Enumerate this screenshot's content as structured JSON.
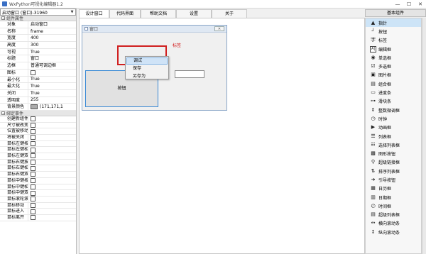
{
  "window": {
    "title": "WxPython可视化编辑器1.2",
    "minimize": "—",
    "maximize": "☐",
    "close": "✕"
  },
  "left": {
    "object_selector": "启动窗口 (窗口)-31960",
    "props_section": "组件属性",
    "props": [
      {
        "k": "对象",
        "v": "启动窗口"
      },
      {
        "k": "名称",
        "v": "frame"
      },
      {
        "k": "宽度",
        "v": "400"
      },
      {
        "k": "高度",
        "v": "300"
      },
      {
        "k": "可视",
        "v": "True"
      },
      {
        "k": "标题",
        "v": "窗口"
      },
      {
        "k": "边框",
        "v": "普通可调边框"
      },
      {
        "k": "图标",
        "v": ""
      },
      {
        "k": "最小化",
        "v": "True"
      },
      {
        "k": "最大化",
        "v": "True"
      },
      {
        "k": "关闭",
        "v": "True"
      },
      {
        "k": "透明度",
        "v": "255"
      },
      {
        "k": "背景颜色",
        "v": "(171,171,1"
      }
    ],
    "events_section": "绑定事件",
    "events": [
      "创建新组件",
      "尺寸被改变",
      "位置被移动",
      "将被关闭",
      "鼠标左键按下",
      "鼠标左键松开",
      "鼠标左键双击",
      "鼠标右键按下",
      "鼠标右键松开",
      "鼠标右键双击",
      "鼠标中键按下",
      "鼠标中键松开",
      "鼠标中键双击",
      "鼠标滚轮滚动",
      "鼠标移动",
      "鼠标进入",
      "鼠标离开"
    ]
  },
  "tabs": [
    {
      "label": "设计窗口",
      "active": true
    },
    {
      "label": "代码界面",
      "active": false
    },
    {
      "label": "帮助文档",
      "active": false
    },
    {
      "label": "设置",
      "active": false
    },
    {
      "label": "关于",
      "active": false
    }
  ],
  "designer": {
    "frame_title": "窗口",
    "frame_close": "✕",
    "label_text": "标签",
    "button_text": "按钮",
    "context_menu": [
      "调试",
      "保存",
      "另存为"
    ]
  },
  "right": {
    "header": "基本组件",
    "components": [
      {
        "label": "指针",
        "icon": "▲"
      },
      {
        "label": "按钮",
        "icon": "┘"
      },
      {
        "label": "标签",
        "icon": "字"
      },
      {
        "label": "编辑框",
        "icon": "A|"
      },
      {
        "label": "单选框",
        "icon": "◉"
      },
      {
        "label": "多选框",
        "icon": "☑"
      },
      {
        "label": "图片框",
        "icon": "▣"
      },
      {
        "label": "组合框",
        "icon": "▤"
      },
      {
        "label": "进度条",
        "icon": "▭"
      },
      {
        "label": "滑块条",
        "icon": "⊶"
      },
      {
        "label": "整数微调框",
        "icon": "⇕"
      },
      {
        "label": "时钟",
        "icon": "◷"
      },
      {
        "label": "动画框",
        "icon": "▶"
      },
      {
        "label": "列表框",
        "icon": "☰"
      },
      {
        "label": "选择列表框",
        "icon": "☷"
      },
      {
        "label": "图形按钮",
        "icon": "▩"
      },
      {
        "label": "超级链接框",
        "icon": "⚲"
      },
      {
        "label": "排序列表框",
        "icon": "⇅"
      },
      {
        "label": "引导按钮",
        "icon": "➜"
      },
      {
        "label": "日历框",
        "icon": "▦"
      },
      {
        "label": "日期框",
        "icon": "▥"
      },
      {
        "label": "时间框",
        "icon": "◴"
      },
      {
        "label": "超级列表框",
        "icon": "▤"
      },
      {
        "label": "横向滚动条",
        "icon": "↔"
      },
      {
        "label": "纵向滚动条",
        "icon": "↕"
      }
    ]
  },
  "colors": {
    "accent_red": "#d02020",
    "selection_blue": "#3a8ad6",
    "menu_highlight": "#cfe3f7"
  }
}
